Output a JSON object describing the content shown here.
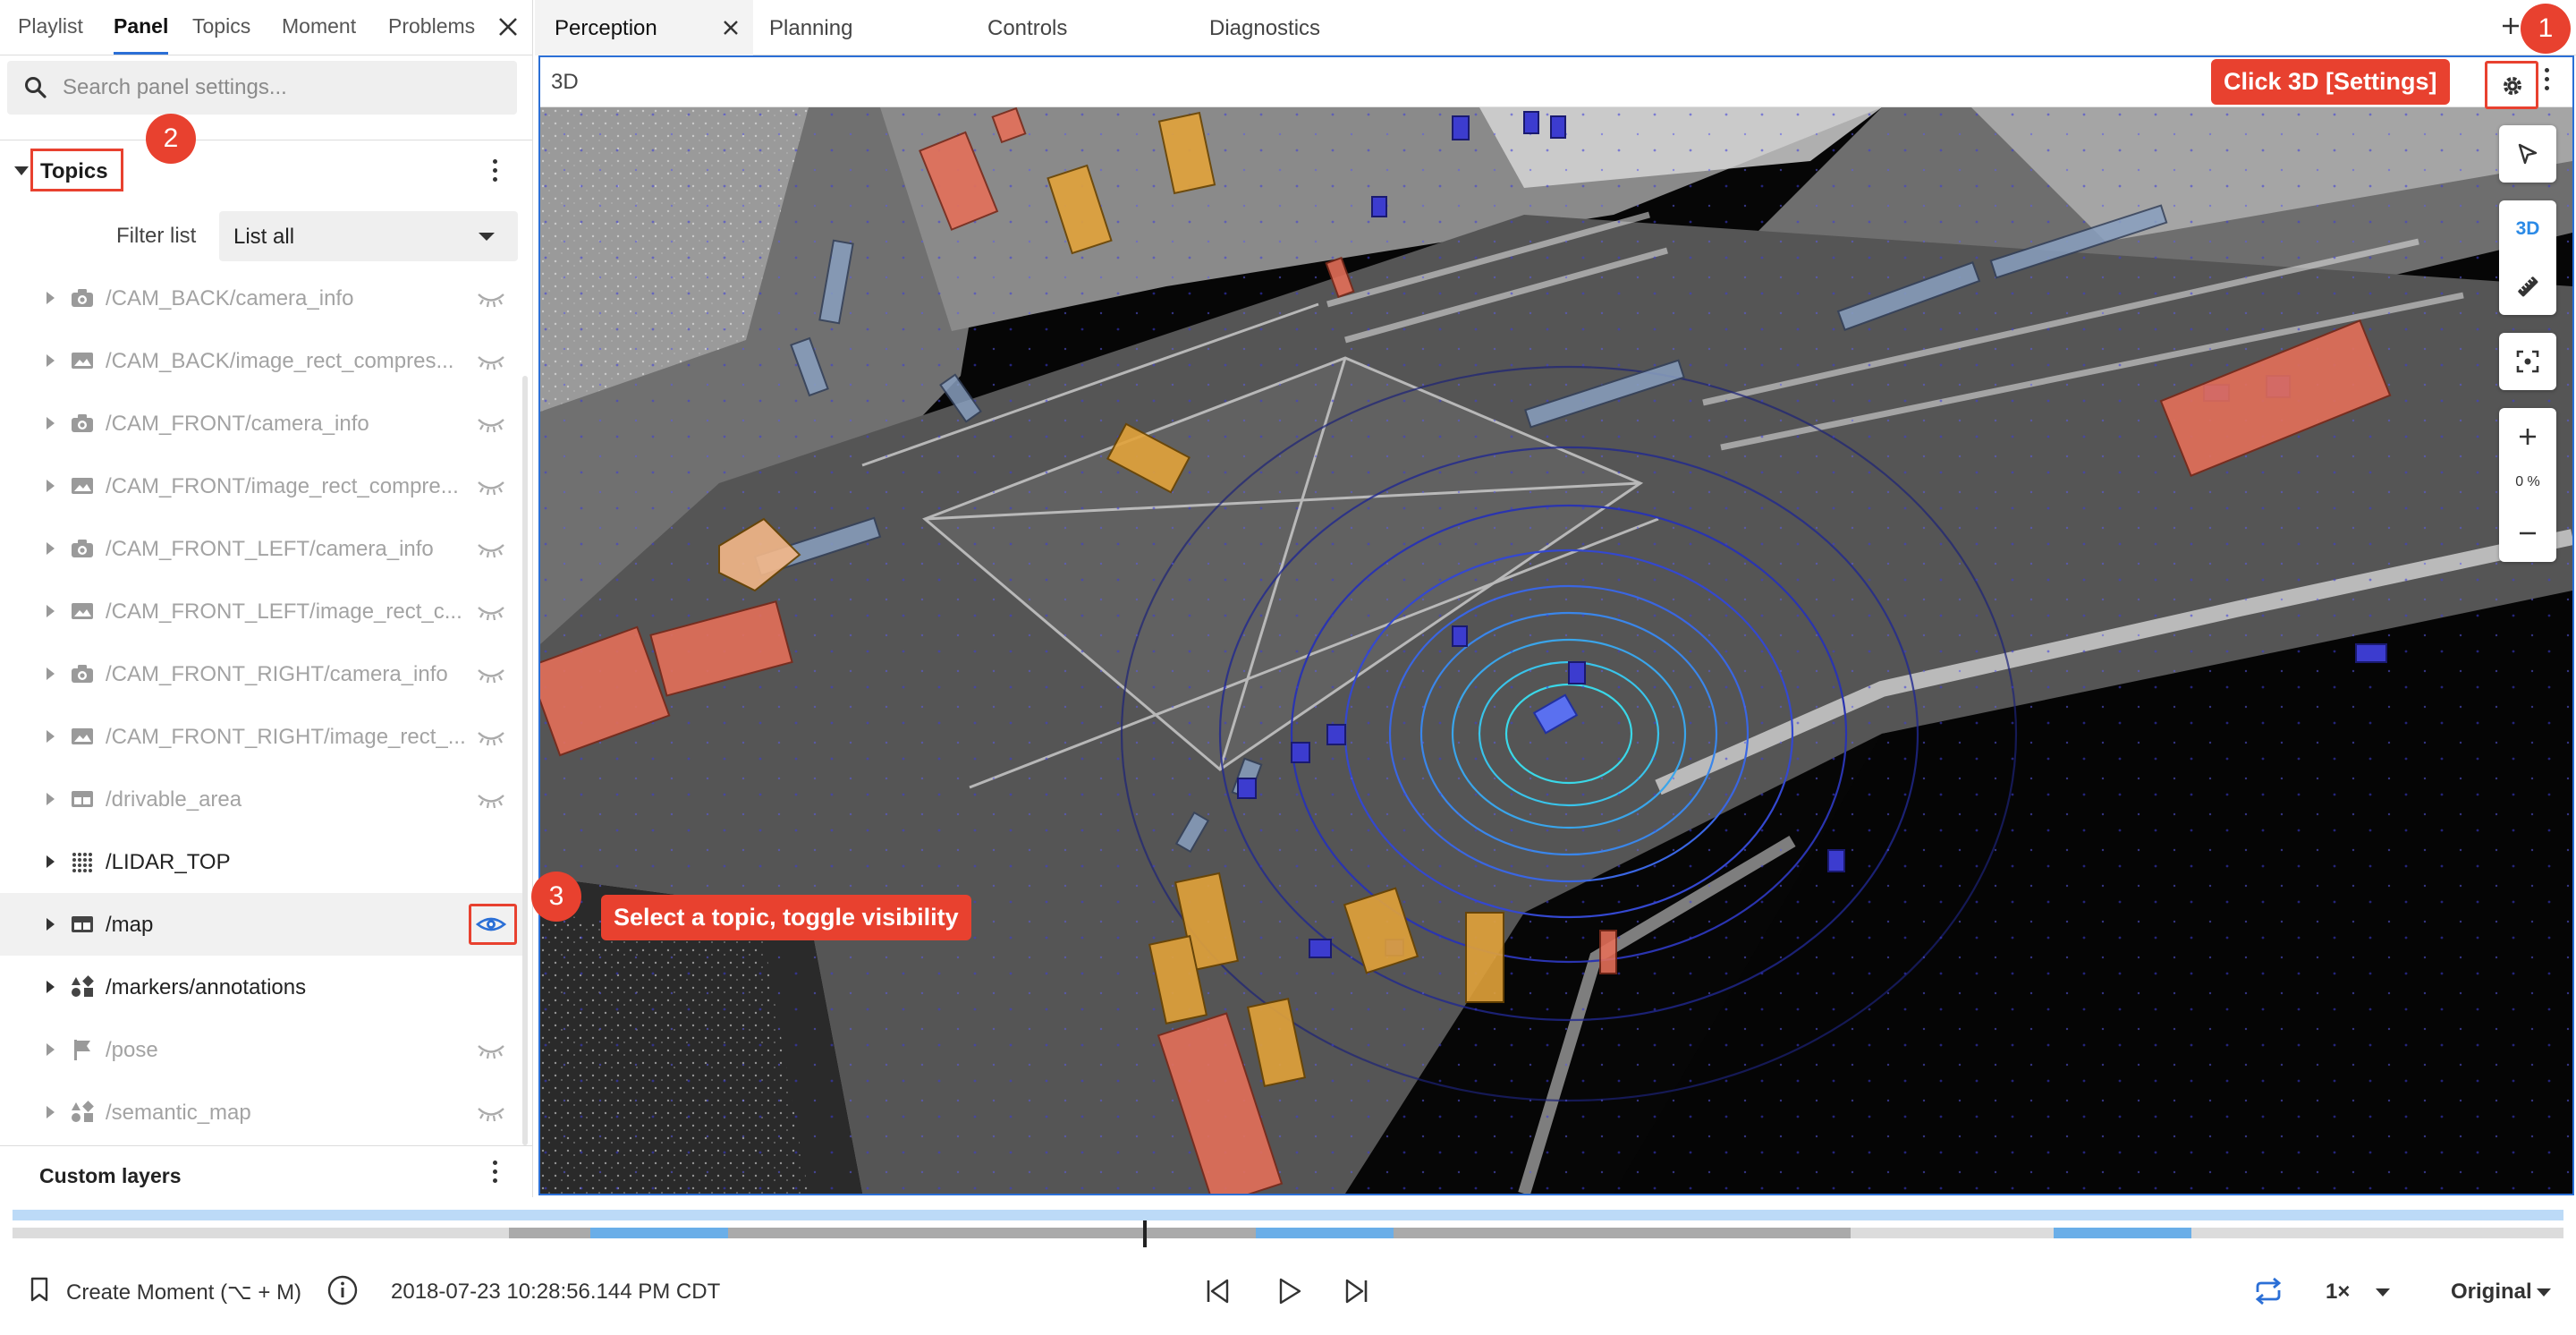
{
  "sidebar": {
    "tabs": [
      {
        "label": "Playlist",
        "active": false
      },
      {
        "label": "Panel",
        "active": true
      },
      {
        "label": "Topics",
        "active": false
      },
      {
        "label": "Moment",
        "active": false
      },
      {
        "label": "Problems",
        "active": false
      }
    ],
    "search": {
      "placeholder": "Search panel settings..."
    },
    "topics_section": {
      "title": "Topics"
    },
    "filter": {
      "label": "Filter list",
      "value": "List all"
    },
    "topics": [
      {
        "label": "/CAM_BACK/camera_info",
        "icon": "camera-icon",
        "visible": false
      },
      {
        "label": "/CAM_BACK/image_rect_compres...",
        "icon": "image-icon",
        "visible": false
      },
      {
        "label": "/CAM_FRONT/camera_info",
        "icon": "camera-icon",
        "visible": false
      },
      {
        "label": "/CAM_FRONT/image_rect_compre...",
        "icon": "image-icon",
        "visible": false
      },
      {
        "label": "/CAM_FRONT_LEFT/camera_info",
        "icon": "camera-icon",
        "visible": false
      },
      {
        "label": "/CAM_FRONT_LEFT/image_rect_c...",
        "icon": "image-icon",
        "visible": false
      },
      {
        "label": "/CAM_FRONT_RIGHT/camera_info",
        "icon": "camera-icon",
        "visible": false
      },
      {
        "label": "/CAM_FRONT_RIGHT/image_rect_...",
        "icon": "image-icon",
        "visible": false
      },
      {
        "label": "/drivable_area",
        "icon": "grid-map-icon",
        "visible": false
      },
      {
        "label": "/LIDAR_TOP",
        "icon": "point-cloud-icon",
        "visible": true
      },
      {
        "label": "/map",
        "icon": "grid-map-icon",
        "visible": true,
        "selected": true
      },
      {
        "label": "/markers/annotations",
        "icon": "shapes-icon",
        "visible": true
      },
      {
        "label": "/pose",
        "icon": "flag-icon",
        "visible": false
      },
      {
        "label": "/semantic_map",
        "icon": "shapes-icon",
        "visible": false
      }
    ],
    "custom_layers": {
      "title": "Custom layers"
    }
  },
  "main": {
    "tabs": [
      {
        "label": "Perception",
        "active": true
      },
      {
        "label": "Planning",
        "active": false
      },
      {
        "label": "Controls",
        "active": false
      },
      {
        "label": "Diagnostics",
        "active": false
      }
    ],
    "panel": {
      "title": "3D"
    },
    "toolbar": {
      "mode_label": "3D",
      "zoom_label": "0 %"
    }
  },
  "annotations": {
    "callout_1": "Click 3D [Settings]",
    "callout_3": "Select a topic, toggle visibility",
    "badge_1": "1",
    "badge_2": "2",
    "badge_3": "3"
  },
  "bottom": {
    "create_moment": "Create Moment (⌥ + M)",
    "timestamp": "2018-07-23 10:28:56.144 PM CDT",
    "speed": "1×",
    "quality": "Original"
  },
  "colors": {
    "accent": "#2b6fd6",
    "callout": "#e8412f",
    "timeline_highlight": "#6aaee8"
  }
}
